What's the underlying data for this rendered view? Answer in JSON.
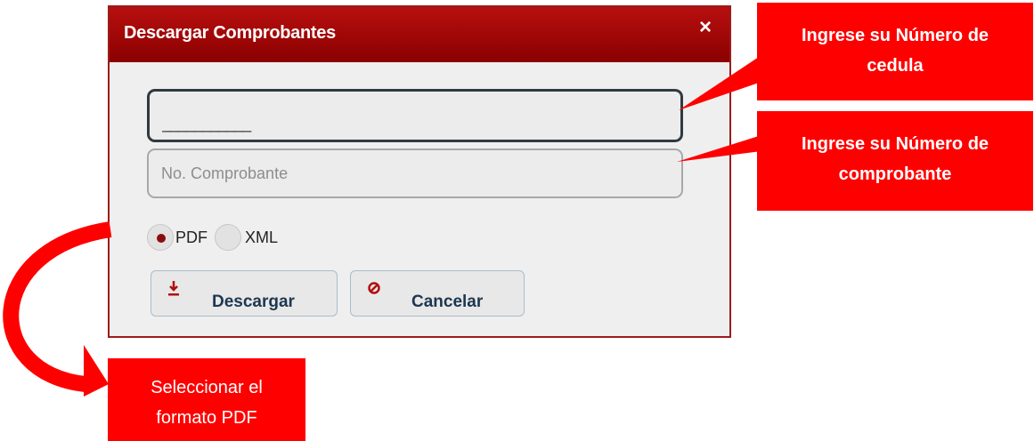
{
  "dialog": {
    "title": "Descargar Comprobantes",
    "close_icon": "×",
    "cedula_value": "___________",
    "comprobante_placeholder": "No. Comprobante",
    "format_options": [
      {
        "label": "PDF",
        "selected": true
      },
      {
        "label": "XML",
        "selected": false
      }
    ],
    "download_label": "Descargar",
    "download_icon": "download-icon",
    "cancel_label": "Cancelar",
    "cancel_icon": "ban-icon"
  },
  "callouts": {
    "cedula": [
      "Ingrese su Número de",
      "cedula"
    ],
    "comprobante": [
      "Ingrese su Número de",
      "comprobante"
    ],
    "formato": [
      "Seleccionar el",
      "formato PDF"
    ]
  },
  "colors": {
    "header": "#a00000",
    "callout": "#ff0000",
    "button_text": "#1d3750",
    "icon_red": "#b20f0f"
  }
}
